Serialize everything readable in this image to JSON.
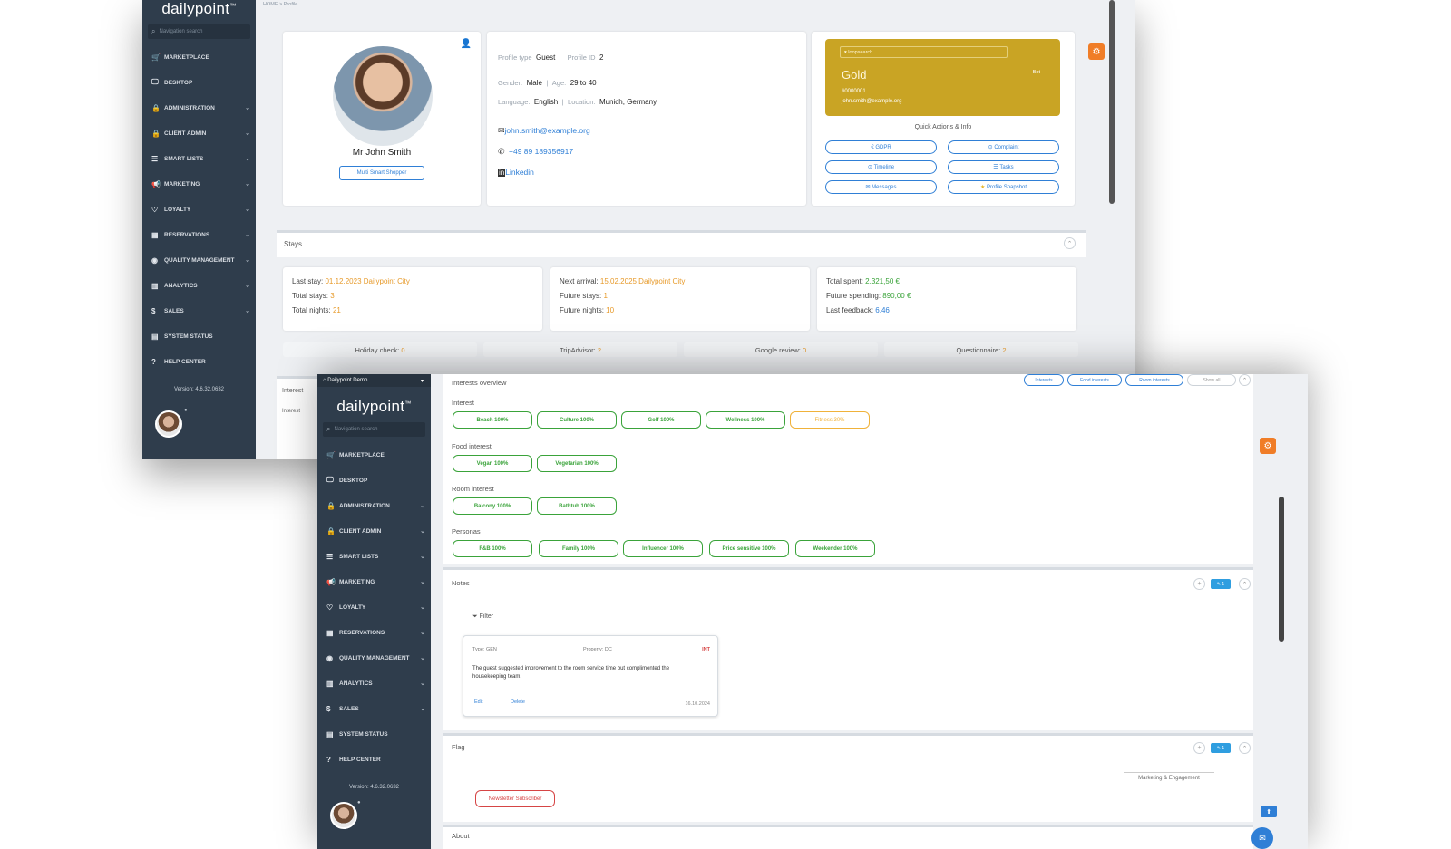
{
  "back_window": {
    "logo": "dailypoint",
    "nav_search_placeholder": "Navigation search",
    "nav": [
      {
        "label": "MARKETPLACE",
        "icon": "cart-icon",
        "chev": false
      },
      {
        "label": "DESKTOP",
        "icon": "monitor-icon",
        "chev": false
      },
      {
        "label": "ADMINISTRATION",
        "icon": "lock-icon",
        "chev": true
      },
      {
        "label": "CLIENT ADMIN",
        "icon": "lock-icon",
        "chev": true
      },
      {
        "label": "SMART LISTS",
        "icon": "list-icon",
        "chev": true
      },
      {
        "label": "MARKETING",
        "icon": "megaphone-icon",
        "chev": true
      },
      {
        "label": "LOYALTY",
        "icon": "heart-icon",
        "chev": true
      },
      {
        "label": "RESERVATIONS",
        "icon": "calendar-icon",
        "chev": true
      },
      {
        "label": "QUALITY MANAGEMENT",
        "icon": "gauge-icon",
        "chev": true
      },
      {
        "label": "ANALYTICS",
        "icon": "chart-icon",
        "chev": true
      },
      {
        "label": "SALES",
        "icon": "dollar-icon",
        "chev": true
      },
      {
        "label": "SYSTEM STATUS",
        "icon": "database-icon",
        "chev": false
      },
      {
        "label": "HELP CENTER",
        "icon": "question-icon",
        "chev": false
      }
    ],
    "version": "Version: 4.6.32.0632",
    "breadcrumb": "HOME > Profile",
    "profile": {
      "name": "Mr John Smith",
      "multi_button": "Multi Smart Shopper",
      "profile_type_label": "Profile type",
      "profile_type": "Guest",
      "profile_id_label": "Profile ID",
      "profile_id": "2",
      "gender_label": "Gender",
      "gender": "Male",
      "age_label": "Age",
      "age": "29 to 40",
      "language_label": "Language",
      "language": "English",
      "location_label": "Location",
      "location": "Munich, Germany",
      "email": "john.smith@example.org",
      "phone": "+49 89 189356917",
      "linkedin": "Linkedin"
    },
    "loyalty_card": {
      "search_placeholder": "loopsearch",
      "tier": "Gold",
      "tier_small": "Bot",
      "number": "#0000001",
      "email": "john.smith@example.org"
    },
    "quick_actions": {
      "title": "Quick Actions & Info",
      "buttons": [
        "GDPR",
        "Complaint",
        "Timeline",
        "Tasks",
        "Messages",
        "Profile Snapshot"
      ]
    },
    "stays": {
      "title": "Stays",
      "last_stay_label": "Last stay:",
      "last_stay": "01.12.2023 Dailypoint City",
      "total_stays_label": "Total stays:",
      "total_stays": "3",
      "total_nights_label": "Total nights:",
      "total_nights": "21",
      "next_arrival_label": "Next arrival:",
      "next_arrival": "15.02.2025 Dailypoint City",
      "future_stays_label": "Future stays:",
      "future_stays": "1",
      "future_nights_label": "Future nights:",
      "future_nights": "10",
      "total_spent_label": "Total spent:",
      "total_spent": "2.321,50 €",
      "future_spending_label": "Future spending:",
      "future_spending": "890,00 €",
      "last_feedback_label": "Last feedback:",
      "last_feedback": "6.46"
    },
    "review_tabs": [
      {
        "label": "Holiday check:",
        "value": "0"
      },
      {
        "label": "TripAdvisor:",
        "value": "2"
      },
      {
        "label": "Google review:",
        "value": "0"
      },
      {
        "label": "Questionnaire:",
        "value": "2"
      }
    ],
    "peek_label": "Interest",
    "peek_label2": "Interest"
  },
  "front_window": {
    "property_select": "Dailypoint Demo",
    "logo": "dailypoint",
    "nav_search_placeholder": "Navigation search",
    "nav": [
      {
        "label": "MARKETPLACE",
        "icon": "cart-icon",
        "chev": false
      },
      {
        "label": "DESKTOP",
        "icon": "monitor-icon",
        "chev": false
      },
      {
        "label": "ADMINISTRATION",
        "icon": "lock-icon",
        "chev": true
      },
      {
        "label": "CLIENT ADMIN",
        "icon": "lock-icon",
        "chev": true
      },
      {
        "label": "SMART LISTS",
        "icon": "list-icon",
        "chev": true
      },
      {
        "label": "MARKETING",
        "icon": "megaphone-icon",
        "chev": true
      },
      {
        "label": "LOYALTY",
        "icon": "heart-icon",
        "chev": true
      },
      {
        "label": "RESERVATIONS",
        "icon": "calendar-icon",
        "chev": true
      },
      {
        "label": "QUALITY MANAGEMENT",
        "icon": "gauge-icon",
        "chev": true
      },
      {
        "label": "ANALYTICS",
        "icon": "chart-icon",
        "chev": true
      },
      {
        "label": "SALES",
        "icon": "dollar-icon",
        "chev": true
      },
      {
        "label": "SYSTEM STATUS",
        "icon": "database-icon",
        "chev": false
      },
      {
        "label": "HELP CENTER",
        "icon": "question-icon",
        "chev": false
      }
    ],
    "version": "Version: 4.6.32.0632",
    "interests": {
      "title": "Interests overview",
      "header_buttons": [
        "Interests",
        "Food interests",
        "Room interests",
        "Show all"
      ],
      "groups": [
        {
          "label": "Interest",
          "pills": [
            "Beach 100%",
            "Culture 100%",
            "Golf 100%",
            "Wellness 100%",
            "Fitness 30%"
          ]
        },
        {
          "label": "Food interest",
          "pills": [
            "Vegan 100%",
            "Vegetarian 100%"
          ]
        },
        {
          "label": "Room interest",
          "pills": [
            "Balcony 100%",
            "Bathtub 100%"
          ]
        },
        {
          "label": "Personas",
          "pills": [
            "F&B 100%",
            "Family 100%",
            "Influencer 100%",
            "Price sensitive 100%",
            "Weekender 100%"
          ]
        }
      ]
    },
    "notes": {
      "title": "Notes",
      "filter": "Filter",
      "note_type": "Type: GEN",
      "note_property": "Property: DC",
      "note_badge": "INT",
      "note_text": "The guest suggested improvement to the room service time but complimented the housekeeping team.",
      "edit": "Edit",
      "delete": "Delete",
      "date": "16.10.2024"
    },
    "flag": {
      "title": "Flag",
      "category": "Marketing & Engagement",
      "pill": "Newsletter Subscriber"
    },
    "about_title": "About"
  }
}
